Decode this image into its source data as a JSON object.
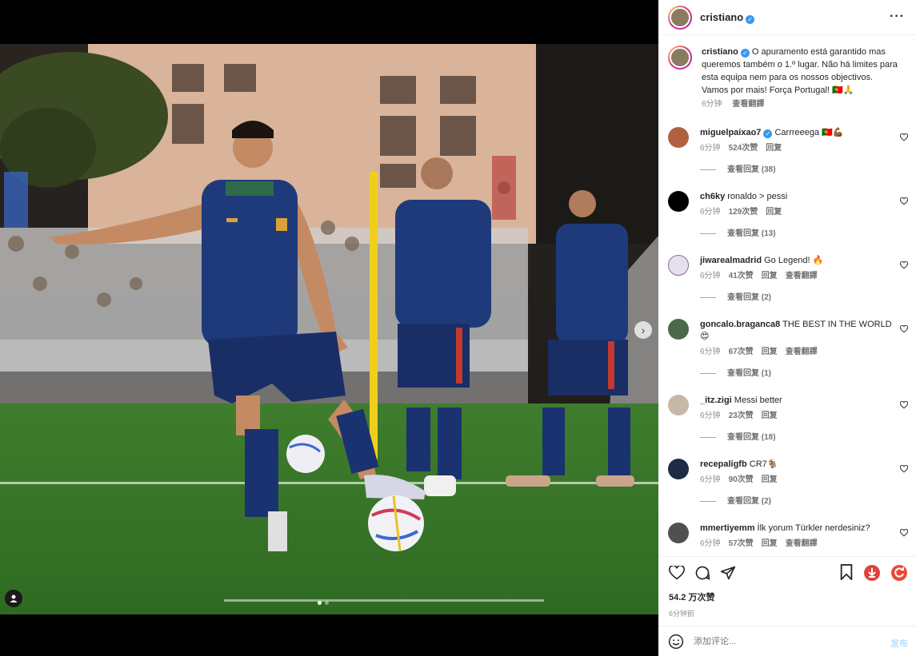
{
  "author": {
    "username": "cristiano",
    "verified_mark": "✓"
  },
  "caption": {
    "username": "cristiano",
    "text": "O apuramento está garantido mas queremos também o 1.º lugar. Não há limites para esta equipa nem para os nossos objectivos. Vamos por mais! Força Portugal! 🇵🇹🙏",
    "time": "6分钟",
    "translate": "查看翻譯"
  },
  "comments": [
    {
      "username": "miguelpaixao7",
      "verified": true,
      "text": "Carrreeega 🇵🇹💪🏾",
      "time": "6分钟",
      "likes": "524次赞",
      "reply": "回复",
      "translate": "",
      "view_replies": "查看回复 (38)",
      "avatar_color": "#b06040"
    },
    {
      "username": "ch6ky",
      "verified": false,
      "text": "ronaldo > pessi",
      "time": "6分钟",
      "likes": "129次赞",
      "reply": "回复",
      "translate": "",
      "view_replies": "查看回复 (13)",
      "avatar_color": "#000000"
    },
    {
      "username": "jiwarealmadrid",
      "verified": false,
      "text": "Go Legend! 🔥",
      "time": "6分钟",
      "likes": "41次赞",
      "reply": "回复",
      "translate": "查看翻譯",
      "view_replies": "查看回复 (2)",
      "avatar_color": "#e6e0ee"
    },
    {
      "username": "goncalo.braganca8",
      "verified": false,
      "text": "THE BEST IN THE WORLD 😍",
      "time": "6分钟",
      "likes": "67次赞",
      "reply": "回复",
      "translate": "查看翻譯",
      "view_replies": "查看回复 (1)",
      "avatar_color": "#4a6a4a"
    },
    {
      "username": "_itz.zigi",
      "verified": false,
      "text": "Messi better",
      "time": "6分钟",
      "likes": "23次赞",
      "reply": "回复",
      "translate": "",
      "view_replies": "查看回复 (18)",
      "avatar_color": "#c8b8a8"
    },
    {
      "username": "recepaligfb",
      "verified": false,
      "text": "CR7🐐",
      "time": "6分钟",
      "likes": "90次赞",
      "reply": "回复",
      "translate": "",
      "view_replies": "查看回复 (2)",
      "avatar_color": "#1f2a44"
    },
    {
      "username": "mmertiyemm",
      "verified": false,
      "text": "İlk yorum Türkler nerdesiniz?",
      "time": "6分钟",
      "likes": "57次赞",
      "reply": "回复",
      "translate": "查看翻譯",
      "view_replies": "",
      "avatar_color": "#505050"
    }
  ],
  "stats": {
    "likes": "54.2 万次赞",
    "posted": "6分钟前"
  },
  "composer": {
    "placeholder": "添加评论...",
    "post": "发布"
  },
  "icons": {
    "like": "heart-icon",
    "comment": "comment-icon",
    "share": "share-icon",
    "save": "bookmark-icon",
    "download": "download-icon",
    "refresh": "refresh-icon",
    "emoji": "emoji-icon",
    "more": "more-icon"
  },
  "colors": {
    "accent": "#3897f0",
    "post_disabled": "#b2dffc",
    "download_red": "#e0433b",
    "refresh_red": "#e84b3c"
  }
}
